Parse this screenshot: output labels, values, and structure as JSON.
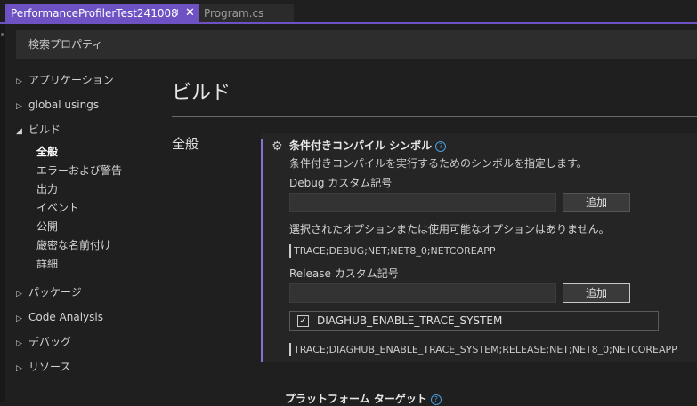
{
  "tabs": [
    {
      "label": "PerformanceProfilerTest241008",
      "active": true
    },
    {
      "label": "Program.cs",
      "active": false
    }
  ],
  "search": {
    "placeholder": "検索プロパティ"
  },
  "sidebar": {
    "items": [
      {
        "label": "アプリケーション",
        "expanded": false
      },
      {
        "label": "global usings",
        "expanded": false
      },
      {
        "label": "ビルド",
        "expanded": true
      },
      {
        "label": "パッケージ",
        "expanded": false
      },
      {
        "label": "Code Analysis",
        "expanded": false
      },
      {
        "label": "デバッグ",
        "expanded": false
      },
      {
        "label": "リソース",
        "expanded": false
      }
    ],
    "build_subitems": [
      "全般",
      "エラーおよび警告",
      "出力",
      "イベント",
      "公開",
      "厳密な名前付け",
      "詳細"
    ],
    "selected_subitem": "全般"
  },
  "page": {
    "title": "ビルド",
    "section": "全般"
  },
  "conditional_symbols": {
    "title": "条件付きコンパイル シンボル",
    "description": "条件付きコンパイルを実行するためのシンボルを指定します。",
    "debug_label": "Debug カスタム記号",
    "debug_value": "",
    "add_label": "追加",
    "no_options": "選択されたオプションまたは使用可能なオプションはありません。",
    "debug_result": "TRACE;DEBUG;NET;NET8_0;NETCOREAPP",
    "release_label": "Release カスタム記号",
    "release_value": "",
    "release_option": {
      "label": "DIAGHUB_ENABLE_TRACE_SYSTEM",
      "checked": true
    },
    "release_result": "TRACE;DIAGHUB_ENABLE_TRACE_SYSTEM;RELEASE;NET;NET8_0;NETCOREAPP"
  },
  "platform_target": {
    "title": "プラットフォーム ターゲット"
  },
  "colors": {
    "accent": "#6e52c4",
    "background": "#1f1f1f",
    "help": "#4a9fe0"
  }
}
